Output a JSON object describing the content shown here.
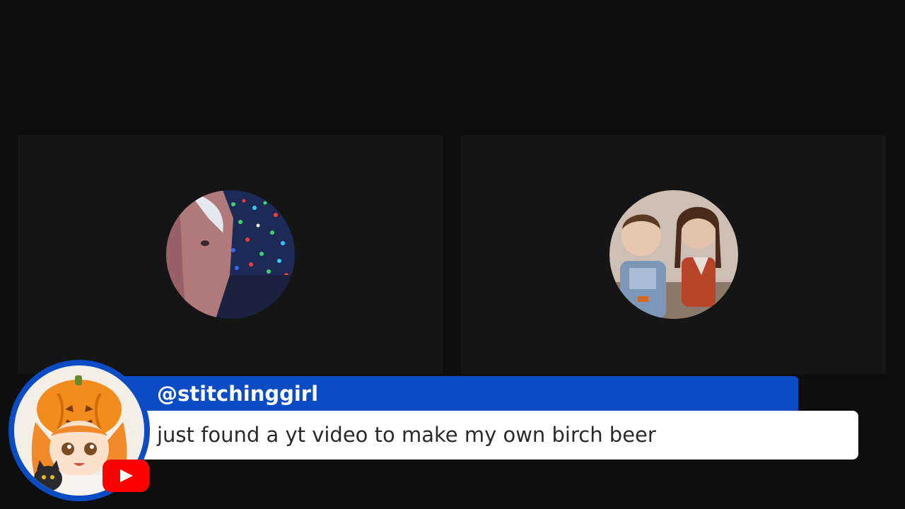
{
  "chat": {
    "username": "@stitchinggirl",
    "message": "just found a yt video to make my own birch beer",
    "platform_icon": "youtube-icon",
    "colors": {
      "name_bar": "#0b4cc4",
      "message_bar": "#ffffff",
      "badge": "#ff0000"
    }
  },
  "participants": [
    {
      "avatar_icon": "participant-photo-holiday-lights"
    },
    {
      "avatar_icon": "participant-photo-two-children"
    }
  ],
  "colors": {
    "background": "#0e0e0f",
    "tile": "#151516"
  }
}
